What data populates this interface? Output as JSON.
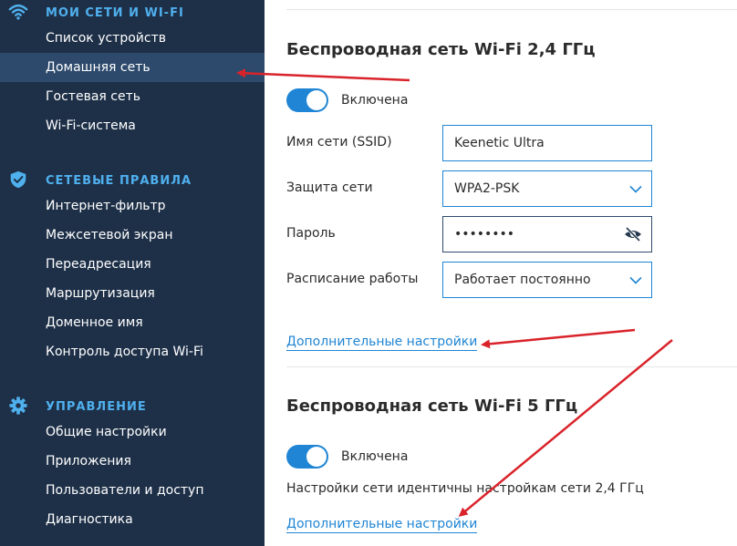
{
  "colors": {
    "sidebar_bg": "#1e3048",
    "sidebar_active": "#2d4a6c",
    "section_title": "#4fb0ee",
    "accent": "#1f85d4",
    "annotation_arrow": "#d9232a"
  },
  "sidebar": {
    "sections": [
      {
        "title": "МОИ СЕТИ И WI-FI",
        "icon": "wifi-icon",
        "items": [
          {
            "label": "Список устройств"
          },
          {
            "label": "Домашняя сеть"
          },
          {
            "label": "Гостевая сеть"
          },
          {
            "label": "Wi-Fi-система"
          }
        ]
      },
      {
        "title": "СЕТЕВЫЕ ПРАВИЛА",
        "icon": "shield-check-icon",
        "items": [
          {
            "label": "Интернет-фильтр"
          },
          {
            "label": "Межсетевой экран"
          },
          {
            "label": "Переадресация"
          },
          {
            "label": "Маршрутизация"
          },
          {
            "label": "Доменное имя"
          },
          {
            "label": "Контроль доступа Wi-Fi"
          }
        ]
      },
      {
        "title": "УПРАВЛЕНИЕ",
        "icon": "gear-icon",
        "items": [
          {
            "label": "Общие настройки"
          },
          {
            "label": "Приложения"
          },
          {
            "label": "Пользователи и доступ"
          },
          {
            "label": "Диагностика"
          }
        ]
      }
    ]
  },
  "main": {
    "wifi24": {
      "title": "Беспроводная сеть Wi-Fi 2,4 ГГц",
      "toggle_label": "Включена",
      "ssid_label": "Имя сети (SSID)",
      "ssid_value": "Keenetic Ultra",
      "security_label": "Защита сети",
      "security_value": "WPA2-PSK",
      "password_label": "Пароль",
      "password_value": "••••••••",
      "schedule_label": "Расписание работы",
      "schedule_value": "Работает постоянно",
      "advanced_link": "Дополнительные настройки"
    },
    "wifi5": {
      "title": "Беспроводная сеть Wi-Fi 5 ГГц",
      "toggle_label": "Включена",
      "note": "Настройки сети идентичны настройкам сети 2,4 ГГц",
      "advanced_link": "Дополнительные настройки"
    }
  }
}
